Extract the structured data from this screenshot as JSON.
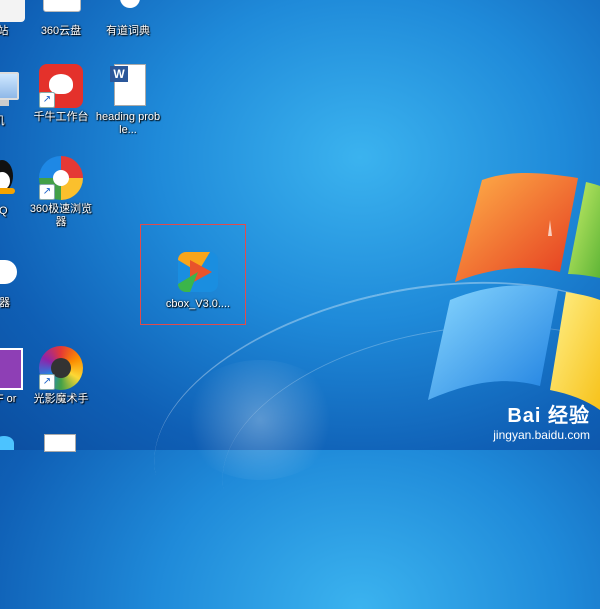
{
  "desktop": {
    "icons": [
      {
        "label": "站"
      },
      {
        "label": "360云盘"
      },
      {
        "label": "有道词典"
      },
      {
        "label": "机"
      },
      {
        "label": "千牛工作台"
      },
      {
        "label": "heading proble..."
      },
      {
        "label": "QQ"
      },
      {
        "label": "360极速浏览器"
      },
      {
        "label": "览器"
      },
      {
        "label": "PDF or"
      },
      {
        "label": "光影魔术手"
      }
    ],
    "selected_icon": {
      "label": "cbox_V3.0...."
    }
  },
  "watermark": {
    "brand": "Bai 经验",
    "url": "jingyan.baidu.com"
  },
  "colors": {
    "selection_border": "#e34b4b",
    "logo_red": "#e8532b",
    "logo_orange": "#f9a51a",
    "logo_green": "#3bb54a",
    "logo_blue": "#1a8ee0"
  }
}
